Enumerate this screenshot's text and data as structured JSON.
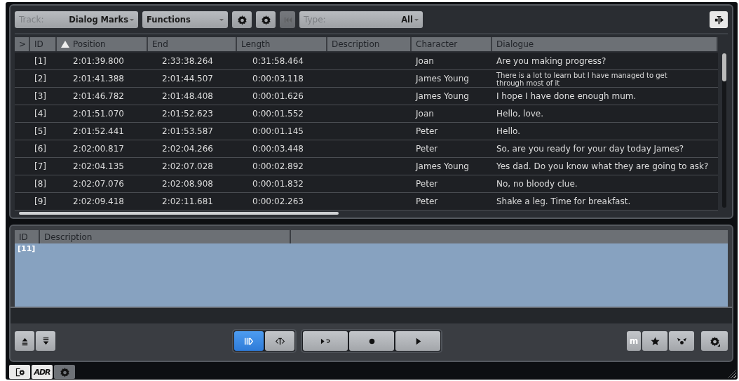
{
  "toolbar": [
    {
      "kind": "dropdown",
      "label": "Track:",
      "value": "Dialog Marks"
    },
    {
      "kind": "dropdown",
      "value": "Functions"
    },
    {
      "kind": "button",
      "disabled": false
    },
    {
      "kind": "button",
      "disabled": false
    },
    {
      "kind": "button",
      "disabled": true
    },
    {
      "kind": "dropdown",
      "label": "Type:",
      "value": "All"
    }
  ],
  "table": {
    "columns": [
      {
        "label": ">",
        "sorted": false
      },
      {
        "label": "ID",
        "sorted": false
      },
      {
        "label": "Position",
        "sorted": true
      },
      {
        "label": "End",
        "sorted": false
      },
      {
        "label": "Length",
        "sorted": false
      },
      {
        "label": "Description",
        "sorted": false
      },
      {
        "label": "Character",
        "sorted": false
      },
      {
        "label": "Dialogue",
        "sorted": false
      }
    ],
    "rows": [
      {
        "id": "[1]",
        "position": "2:01:39.800",
        "end": "2:33:38.264",
        "length": "0:31:58.464",
        "character": "Joan",
        "dialogue": "Are you making progress?"
      },
      {
        "id": "[2]",
        "position": "2:01:41.388",
        "end": "2:01:44.507",
        "length": "0:00:03.118",
        "character": "James Young",
        "dialogue": "There is a lot to learn but I have managed to get through most of it"
      },
      {
        "id": "[3]",
        "position": "2:01:46.782",
        "end": "2:01:48.408",
        "length": "0:00:01.626",
        "character": "James Young",
        "dialogue": "I hope I have done enough mum."
      },
      {
        "id": "[4]",
        "position": "2:01:51.070",
        "end": "2:01:52.623",
        "length": "0:00:01.552",
        "character": "Joan",
        "dialogue": "Hello, love."
      },
      {
        "id": "[5]",
        "position": "2:01:52.441",
        "end": "2:01:53.587",
        "length": "0:00:01.145",
        "character": "Peter",
        "dialogue": "Hello."
      },
      {
        "id": "[6]",
        "position": "2:02:00.817",
        "end": "2:02:04.266",
        "length": "0:00:03.448",
        "character": "Peter",
        "dialogue": "So, are you ready for your day today James?"
      },
      {
        "id": "[7]",
        "position": "2:02:04.135",
        "end": "2:02:07.028",
        "length": "0:00:02.892",
        "character": "James Young",
        "dialogue": "Yes dad. Do you know what they are going to ask?"
      },
      {
        "id": "[8]",
        "position": "2:02:07.076",
        "end": "2:02:08.908",
        "length": "0:00:01.832",
        "character": "Peter",
        "dialogue": "No, no bloody clue."
      },
      {
        "id": "[9]",
        "position": "2:02:09.418",
        "end": "2:02:11.681",
        "length": "0:00:02.263",
        "character": "Peter",
        "dialogue": "Shake a leg. Time for breakfast."
      }
    ]
  },
  "detail_list": {
    "columns": [
      {
        "label": "ID"
      },
      {
        "label": "Description"
      }
    ],
    "rows": [
      {
        "id": "[11]",
        "selected": true
      }
    ]
  },
  "transport": {
    "groups": [
      [
        {
          "selected": false
        },
        {
          "selected": false
        }
      ],
      [
        {
          "selected": true
        },
        {
          "selected": false
        }
      ],
      [
        {
          "selected": false
        },
        {
          "selected": false
        },
        {
          "selected": false
        }
      ],
      [
        {
          "text": "m",
          "selected": false
        },
        {
          "selected": false
        },
        {
          "selected": false
        }
      ],
      [
        {
          "selected": false
        }
      ]
    ]
  },
  "bottom_tabs": [
    {
      "on": true
    },
    {
      "text": "ADR",
      "on": true
    },
    {
      "on": false
    }
  ]
}
